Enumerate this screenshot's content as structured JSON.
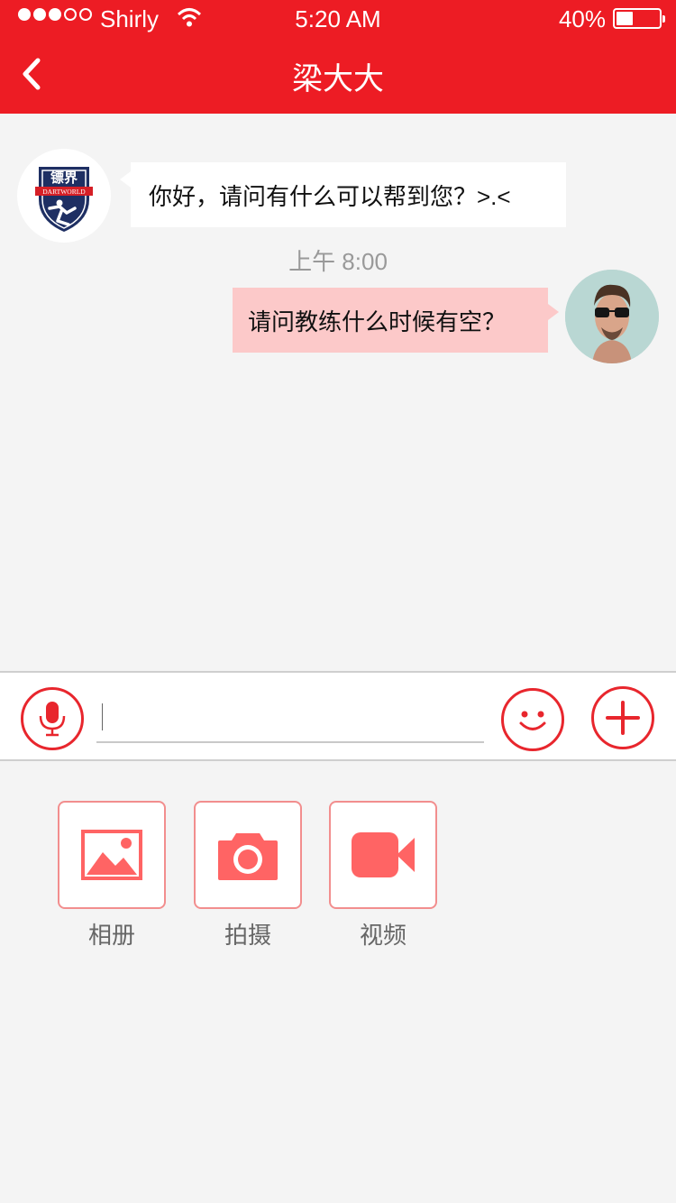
{
  "status_bar": {
    "carrier": "Shirly",
    "time": "5:20 AM",
    "battery": "40%"
  },
  "header": {
    "title": "梁大大"
  },
  "messages": [
    {
      "from": "coach",
      "text": "你好，请问有什么可以帮到您？>.<",
      "avatar_text": "镖界",
      "avatar_subtext": "DARTWORLD"
    },
    {
      "from": "me",
      "text": "请问教练什么时候有空？"
    }
  ],
  "timestamp": "上午 8:00",
  "input": {
    "value": "",
    "placeholder": ""
  },
  "tools": [
    {
      "label": "相册",
      "icon": "image-icon"
    },
    {
      "label": "拍摄",
      "icon": "camera-icon"
    },
    {
      "label": "视频",
      "icon": "video-icon"
    }
  ],
  "colors": {
    "brand_red": "#ed1c24",
    "bubble_out": "#fcc9c9",
    "tool_icon": "#ff6464"
  }
}
